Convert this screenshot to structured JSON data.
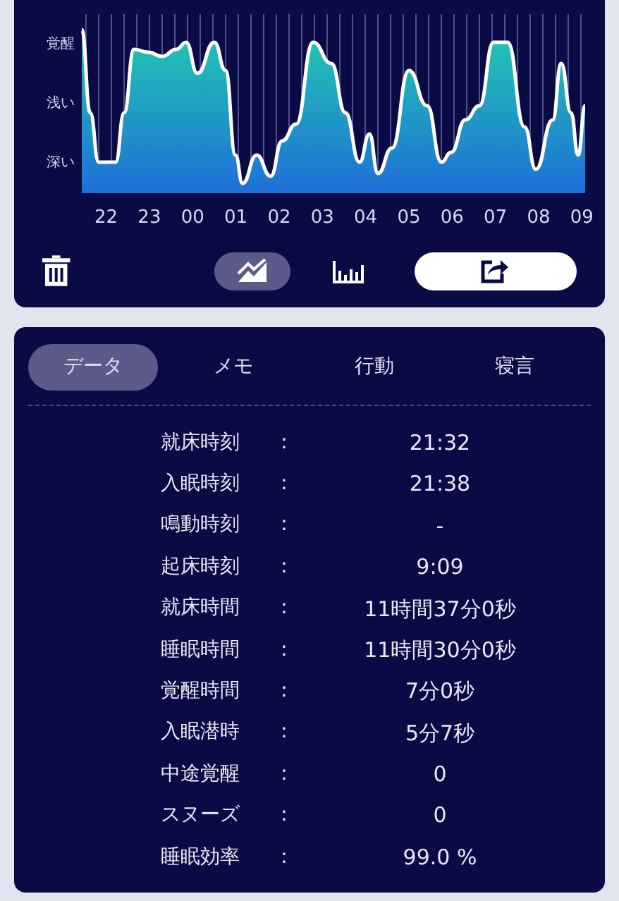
{
  "chart": {
    "y_labels": [
      "覚醒",
      "浅い",
      "深い"
    ],
    "x_labels": [
      "22",
      "23",
      "00",
      "01",
      "02",
      "03",
      "04",
      "05",
      "06",
      "07",
      "08",
      "09"
    ]
  },
  "toolbar": {
    "views": [
      {
        "kind": "line",
        "selected": true
      },
      {
        "kind": "bar",
        "selected": false
      }
    ]
  },
  "tabs": [
    {
      "label": "データ",
      "selected": true
    },
    {
      "label": "メモ",
      "selected": false
    },
    {
      "label": "行動",
      "selected": false
    },
    {
      "label": "寝言",
      "selected": false
    }
  ],
  "rows": [
    {
      "label": "就床時刻",
      "separator": ":",
      "value": "21:32"
    },
    {
      "label": "入眠時刻",
      "separator": ":",
      "value": "21:38"
    },
    {
      "label": "鳴動時刻",
      "separator": ":",
      "value": "-"
    },
    {
      "label": "起床時刻",
      "separator": ":",
      "value": "9:09"
    },
    {
      "label": "就床時間",
      "separator": ":",
      "value": "11時間37分0秒"
    },
    {
      "label": "睡眠時間",
      "separator": ":",
      "value": "11時間30分0秒"
    },
    {
      "label": "覚醒時間",
      "separator": ":",
      "value": "7分0秒"
    },
    {
      "label": "入眠潜時",
      "separator": ":",
      "value": "5分7秒"
    },
    {
      "label": "中途覚醒",
      "separator": ":",
      "value": "0"
    },
    {
      "label": "スヌーズ",
      "separator": ":",
      "value": "0"
    },
    {
      "label": "睡眠効率",
      "separator": ":",
      "value": "99.0 %"
    }
  ]
}
